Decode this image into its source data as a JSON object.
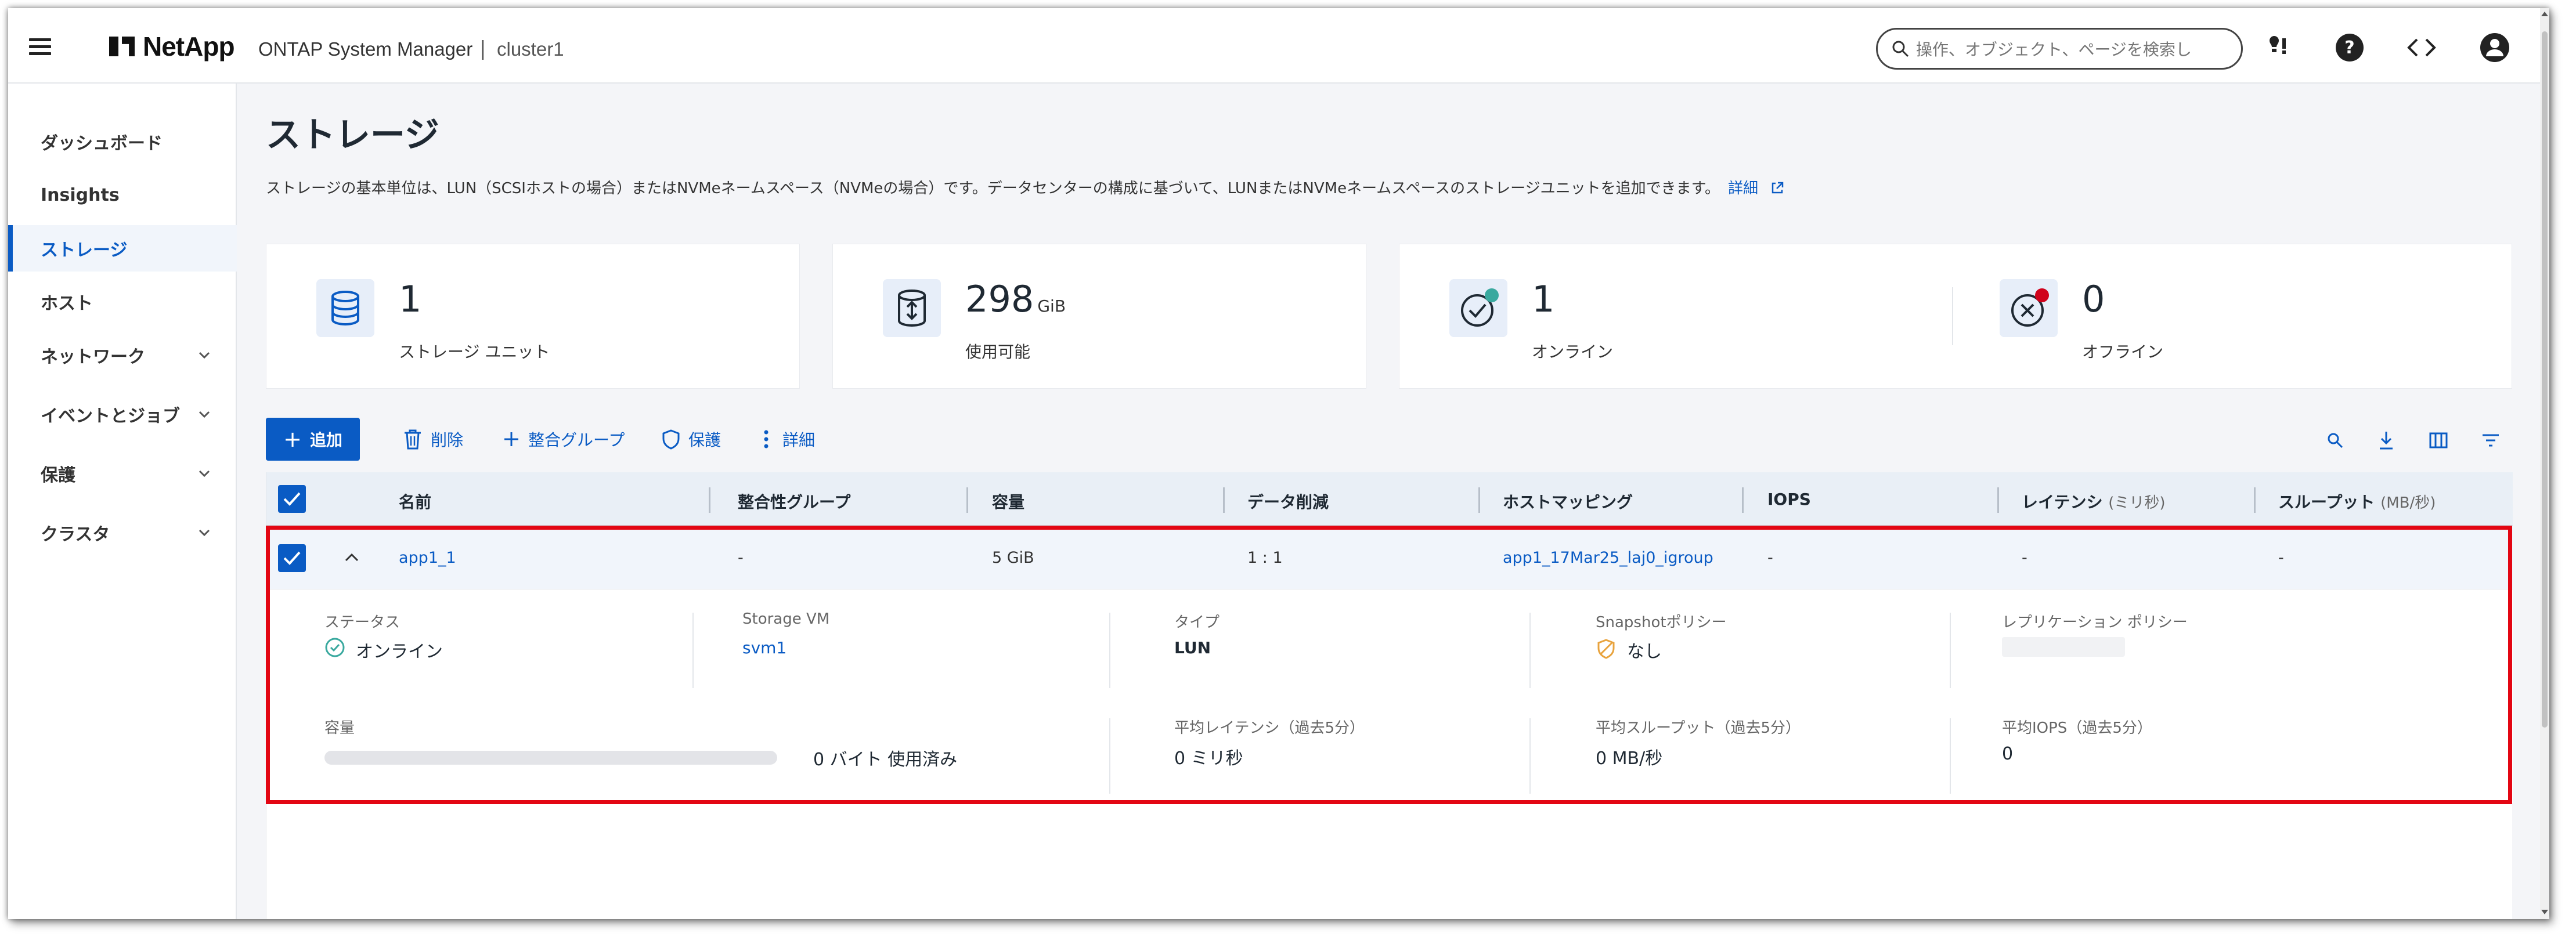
{
  "header": {
    "brand": "NetApp",
    "app_title": "ONTAP System Manager",
    "separator": "|",
    "cluster": "cluster1",
    "search_placeholder": "操作、オブジェクト、ページを検索し"
  },
  "sidebar": {
    "items": [
      {
        "label": "ダッシュボード"
      },
      {
        "label": "Insights"
      },
      {
        "label": "ストレージ"
      },
      {
        "label": "ホスト"
      },
      {
        "label": "ネットワーク"
      },
      {
        "label": "イベントとジョブ"
      },
      {
        "label": "保護"
      },
      {
        "label": "クラスタ"
      }
    ]
  },
  "page": {
    "title": "ストレージ",
    "description": "ストレージの基本単位は、LUN（SCSIホストの場合）またはNVMeネームスペース（NVMeの場合）です。データセンターの構成に基づいて、LUNまたはNVMeネームスペースのストレージユニットを追加できます。",
    "details_link": "詳細"
  },
  "stats": {
    "storage_units": {
      "value": "1",
      "label": "ストレージ ユニット"
    },
    "available": {
      "value": "298",
      "unit": "GiB",
      "label": "使用可能"
    },
    "online": {
      "value": "1",
      "label": "オンライン"
    },
    "offline": {
      "value": "0",
      "label": "オフライン"
    }
  },
  "toolbar": {
    "add": "追加",
    "delete": "削除",
    "consistency_group": "整合グループ",
    "protect": "保護",
    "more": "詳細"
  },
  "table": {
    "headers": {
      "name": "名前",
      "cg": "整合性グループ",
      "capacity": "容量",
      "reduction": "データ削減",
      "host_mapping": "ホストマッピング",
      "iops": "IOPS",
      "latency": "レイテンシ",
      "latency_unit": "(ミリ秒)",
      "throughput": "スループット",
      "throughput_unit": "(MB/秒)"
    },
    "row": {
      "name": "app1_1",
      "cg": "-",
      "capacity": "5 GiB",
      "reduction": "1 : 1",
      "host_mapping": "app1_17Mar25_laj0_igroup",
      "iops": "-",
      "latency": "-",
      "throughput": "-"
    },
    "detail": {
      "status_label": "ステータス",
      "status_value": "オンライン",
      "svm_label": "Storage VM",
      "svm_value": "svm1",
      "type_label": "タイプ",
      "type_value": "LUN",
      "snapshot_label": "Snapshotポリシー",
      "snapshot_value": "なし",
      "replication_label": "レプリケーション ポリシー",
      "capacity_label": "容量",
      "used_text": "0 バイト 使用済み",
      "used_fraction": 0,
      "avg_latency_label": "平均レイテンシ（過去5分）",
      "avg_latency_value": "0 ミリ秒",
      "avg_throughput_label": "平均スループット（過去5分）",
      "avg_throughput_value": "0 MB/秒",
      "avg_iops_label": "平均IOPS（過去5分）",
      "avg_iops_value": "0"
    }
  },
  "colors": {
    "accent": "#0a5bc4",
    "highlight_border": "#e30613",
    "online": "#3aa99f",
    "offline": "#d0021b",
    "snapshot_icon": "#e8a33d"
  }
}
